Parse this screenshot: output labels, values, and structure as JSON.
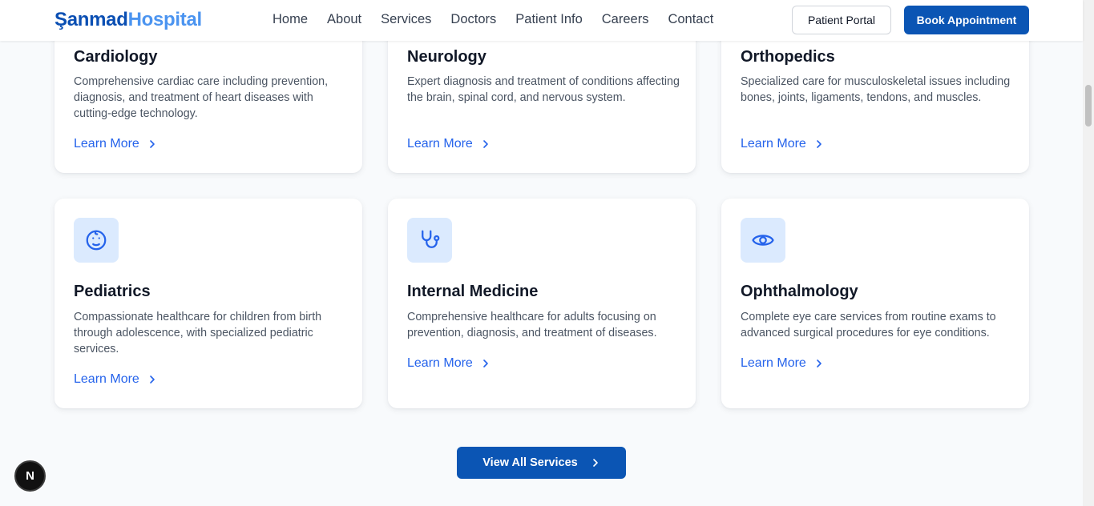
{
  "brand": {
    "part1": "Şanmad",
    "part2": "Hospital",
    "color1": "#0b4fb3",
    "color2": "#4b94f0"
  },
  "nav": [
    "Home",
    "About",
    "Services",
    "Doctors",
    "Patient Info",
    "Careers",
    "Contact"
  ],
  "header_buttons": {
    "portal": "Patient Portal",
    "book": "Book Appointment"
  },
  "cards": [
    {
      "title": "Cardiology",
      "desc": "Comprehensive cardiac care including prevention, diagnosis, and treatment of heart diseases with cutting-edge technology.",
      "link": "Learn More"
    },
    {
      "title": "Neurology",
      "desc": "Expert diagnosis and treatment of conditions affecting the brain, spinal cord, and nervous system.",
      "link": "Learn More"
    },
    {
      "title": "Orthopedics",
      "desc": "Specialized care for musculoskeletal issues including bones, joints, ligaments, tendons, and muscles.",
      "link": "Learn More"
    },
    {
      "title": "Pediatrics",
      "icon": "baby-face-icon",
      "desc": "Compassionate healthcare for children from birth through adolescence, with specialized pediatric services.",
      "link": "Learn More"
    },
    {
      "title": "Internal Medicine",
      "icon": "stethoscope-icon",
      "desc": "Comprehensive healthcare for adults focusing on prevention, diagnosis, and treatment of diseases.",
      "link": "Learn More"
    },
    {
      "title": "Ophthalmology",
      "icon": "eye-icon",
      "desc": "Complete eye care services from routine exams to advanced surgical procedures for eye conditions.",
      "link": "Learn More"
    }
  ],
  "view_all": "View All Services",
  "badge": "N",
  "colors": {
    "accent": "#0b55b4",
    "link": "#2563eb",
    "icon_bg": "#dbeafe"
  }
}
